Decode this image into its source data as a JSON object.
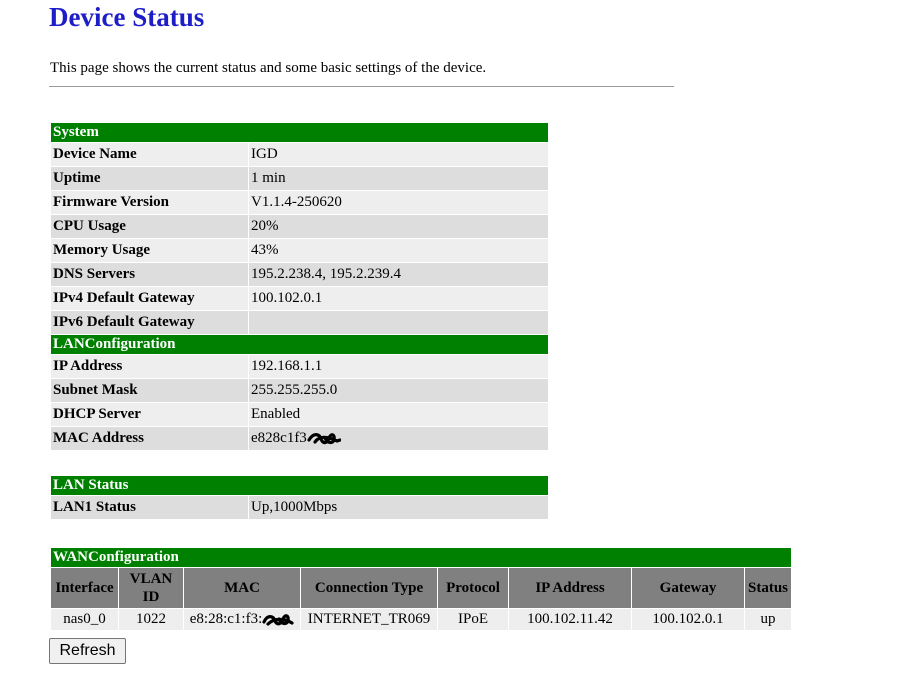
{
  "page": {
    "title": "Device Status",
    "description": "This page shows the current status and some basic settings of the device."
  },
  "system": {
    "header": "System",
    "rows": [
      {
        "label": "Device Name",
        "value": "IGD"
      },
      {
        "label": "Uptime",
        "value": "1 min"
      },
      {
        "label": "Firmware Version",
        "value": "V1.1.4-250620"
      },
      {
        "label": "CPU Usage",
        "value": "20%"
      },
      {
        "label": "Memory Usage",
        "value": "43%"
      },
      {
        "label": "DNS Servers",
        "value": "195.2.238.4, 195.2.239.4"
      },
      {
        "label": "IPv4 Default Gateway",
        "value": "100.102.0.1"
      },
      {
        "label": "IPv6 Default Gateway",
        "value": ""
      }
    ]
  },
  "lan_config": {
    "header": "LANConfiguration",
    "rows": [
      {
        "label": "IP Address",
        "value": "192.168.1.1"
      },
      {
        "label": "Subnet Mask",
        "value": "255.255.255.0"
      },
      {
        "label": "DHCP Server",
        "value": "Enabled"
      },
      {
        "label": "MAC Address",
        "value": "e828c1f3"
      }
    ]
  },
  "lan_status": {
    "header": "LAN Status",
    "rows": [
      {
        "label": "LAN1 Status",
        "value": "Up,1000Mbps"
      }
    ]
  },
  "wan_config": {
    "header": "WANConfiguration",
    "columns": [
      "Interface",
      "VLAN ID",
      "MAC",
      "Connection Type",
      "Protocol",
      "IP Address",
      "Gateway",
      "Status"
    ],
    "rows": [
      {
        "interface": "nas0_0",
        "vlan_id": "1022",
        "mac": "e8:28:c1:f3:",
        "connection_type": "INTERNET_TR069",
        "protocol": "IPoE",
        "ip_address": "100.102.11.42",
        "gateway": "100.102.0.1",
        "status": "up"
      }
    ]
  },
  "actions": {
    "refresh_label": "Refresh"
  }
}
